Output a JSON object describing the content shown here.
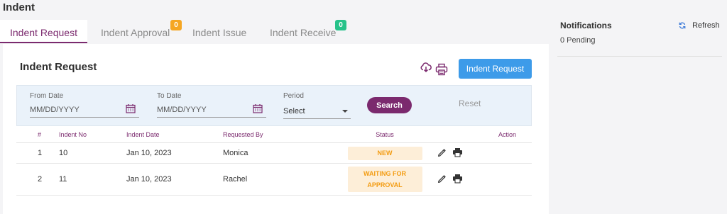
{
  "page": {
    "title": "Indent"
  },
  "tabs": [
    {
      "label": "Indent Request",
      "active": true
    },
    {
      "label": "Indent Approval",
      "badge": "0",
      "badge_color": "#f5a623"
    },
    {
      "label": "Indent Issue"
    },
    {
      "label": "Indent Receive",
      "badge": "0",
      "badge_color": "#27c28a"
    }
  ],
  "card": {
    "title": "Indent Request",
    "download_icon": "cloud-download-icon",
    "print_icon": "printer-icon",
    "primary_button": "Indent Request"
  },
  "filters": {
    "from_label": "From Date",
    "from_placeholder": "MM/DD/YYYY",
    "to_label": "To Date",
    "to_placeholder": "MM/DD/YYYY",
    "calendar_icon": "calendar-icon",
    "period_label": "Period",
    "period_value": "Select",
    "search_label": "Search",
    "reset_label": "Reset"
  },
  "table": {
    "columns": [
      "#",
      "Indent No",
      "Indent Date",
      "Requested By",
      "Status",
      "Action"
    ],
    "rows": [
      {
        "num": "1",
        "indent_no": "10",
        "date": "Jan 10, 2023",
        "requested_by": "Monica",
        "status": [
          "NEW"
        ]
      },
      {
        "num": "2",
        "indent_no": "11",
        "date": "Jan 10, 2023",
        "requested_by": "Rachel",
        "status": [
          "WAITING FOR",
          "APPROVAL"
        ]
      }
    ],
    "action_icons": [
      "pencil-icon",
      "printer-icon"
    ]
  },
  "notifications": {
    "title": "Notifications",
    "pending": "0 Pending",
    "refresh_label": "Refresh",
    "refresh_icon": "refresh-icon"
  },
  "colors": {
    "accent": "#7b2a6e",
    "primary": "#3d9be9",
    "status_text": "#f39c12",
    "status_bg": "#fdeed8"
  }
}
